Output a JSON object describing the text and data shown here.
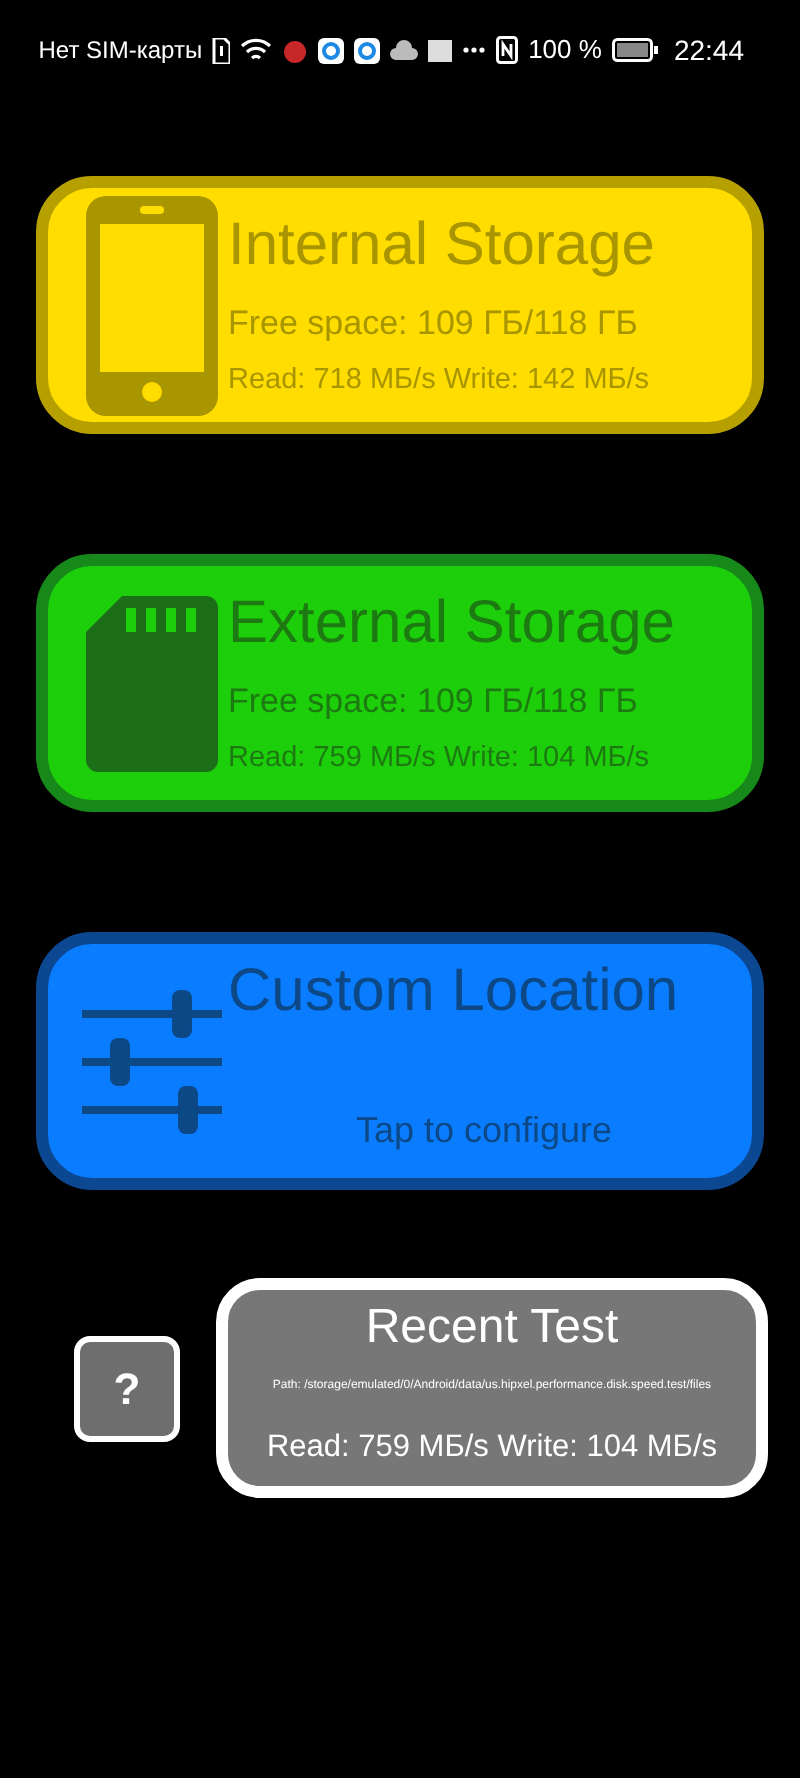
{
  "status_bar": {
    "carrier": "Нет SIM-карты",
    "battery": "100 %",
    "time": "22:44"
  },
  "cards": [
    {
      "kind": "internal",
      "title": "Internal Storage",
      "free": "Free space: 109 ГБ/118 ГБ",
      "speed": "Read: 718 МБ/s Write: 142 МБ/s"
    },
    {
      "kind": "external",
      "title": "External Storage",
      "free": "Free space: 109 ГБ/118 ГБ",
      "speed": "Read: 759 МБ/s Write: 104 МБ/s"
    },
    {
      "kind": "custom",
      "title": "Custom Location",
      "hint": "Tap to configure"
    }
  ],
  "help_button": {
    "label": "?"
  },
  "recent_test": {
    "title": "Recent Test",
    "path": "Path: /storage/emulated/0/Android/data/us.hipxel.performance.disk.speed.test/files",
    "speed": "Read: 759 МБ/s Write: 104 МБ/s"
  }
}
